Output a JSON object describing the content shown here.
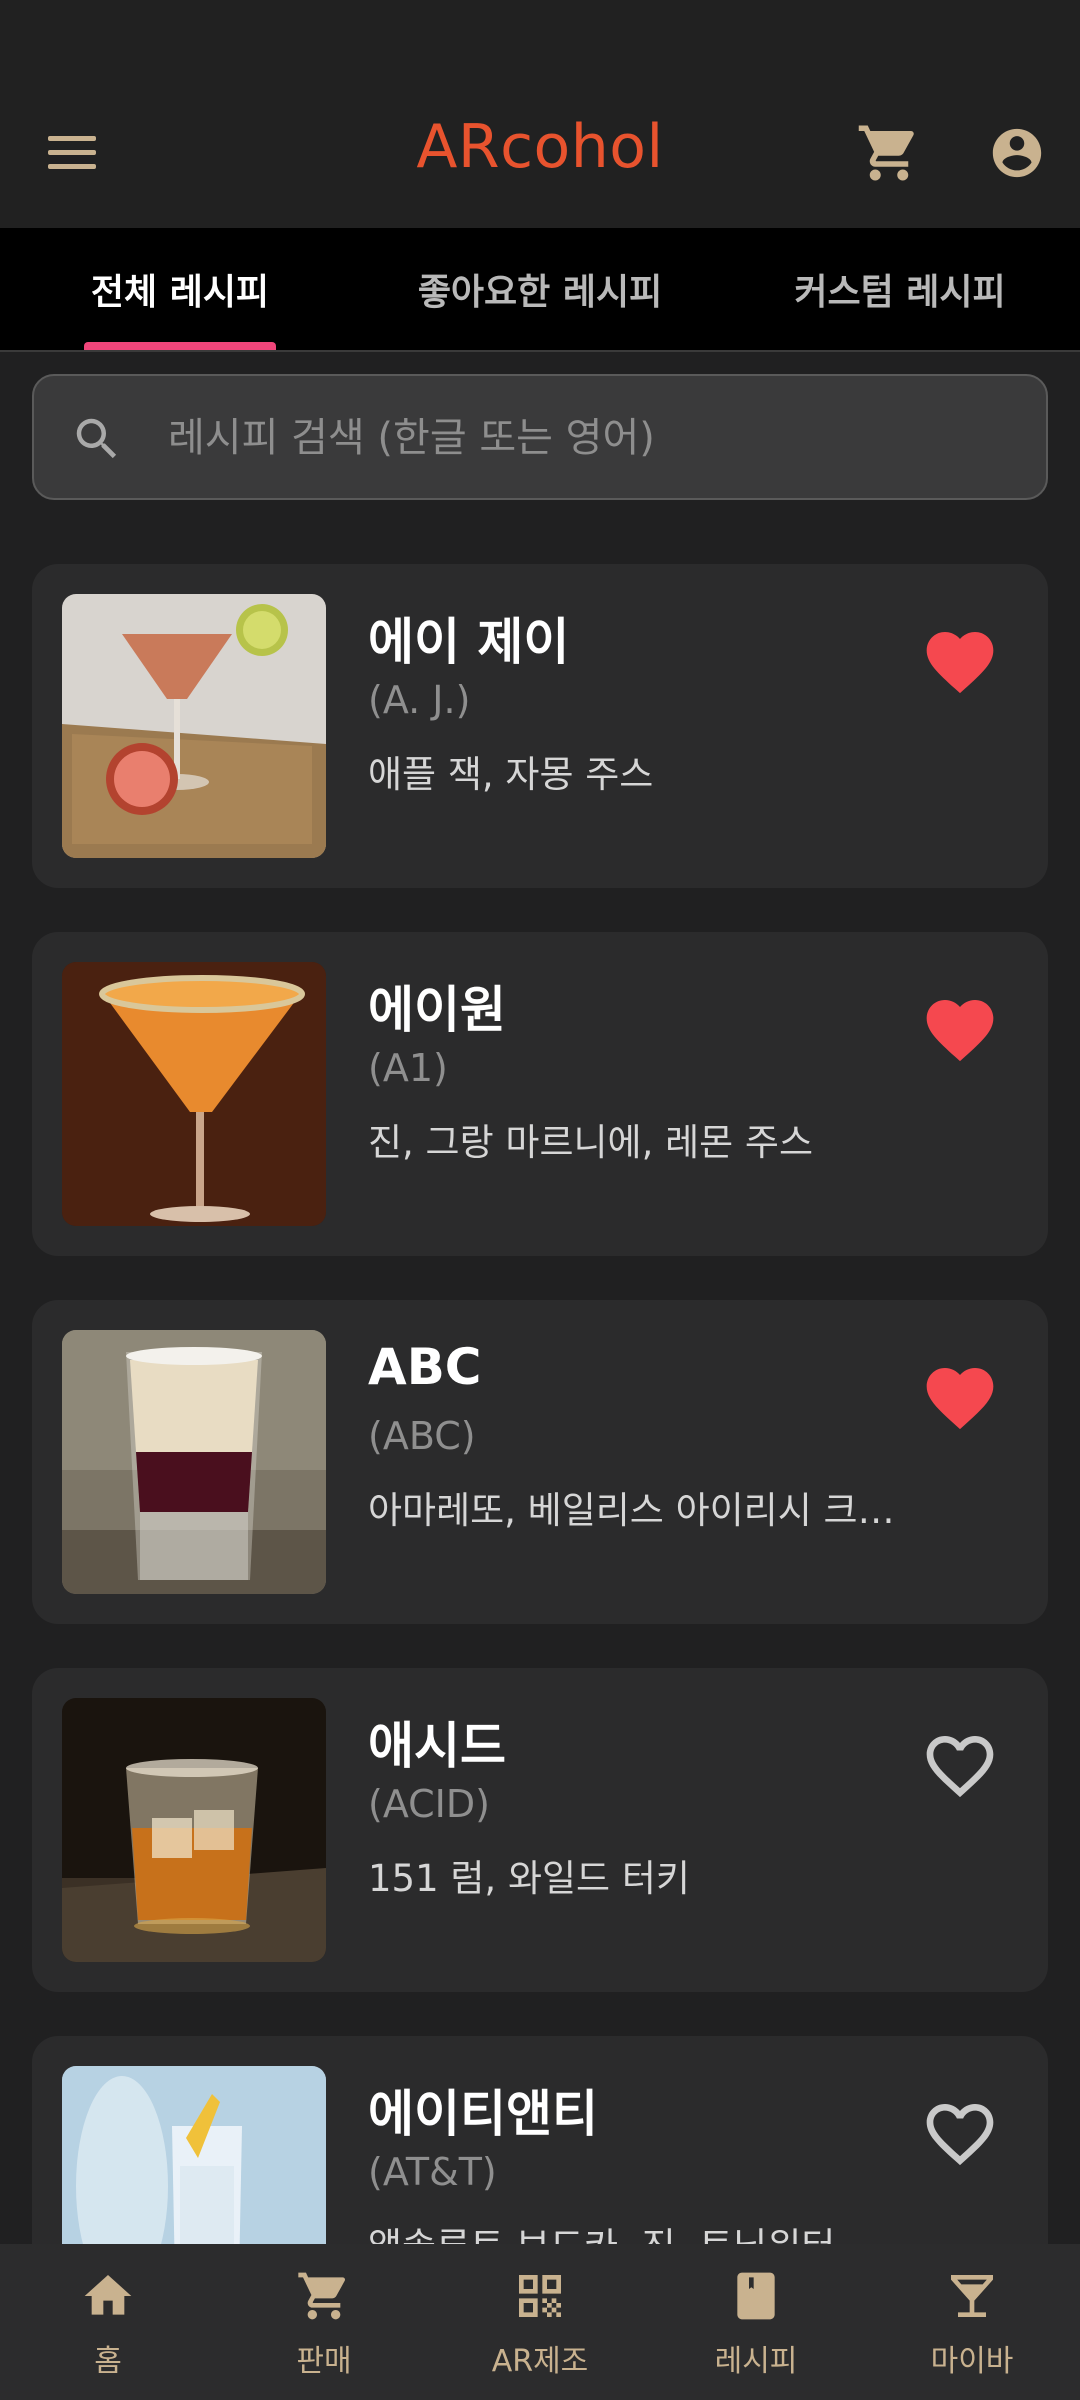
{
  "app": {
    "title": "ARcohol",
    "accent_color": "#e8532e",
    "icon_color": "#c9b28f",
    "tab_indicator_color": "#f0457a"
  },
  "header": {
    "menu_icon": "menu-icon",
    "cart_icon": "cart-icon",
    "account_icon": "account-circle-icon"
  },
  "tabs": [
    {
      "label": "전체 레시피",
      "active": true
    },
    {
      "label": "좋아요한 레시피",
      "active": false
    },
    {
      "label": "커스텀 레시피",
      "active": false
    }
  ],
  "search": {
    "placeholder": "레시피 검색 (한글 또는 영어)",
    "value": ""
  },
  "recipes": [
    {
      "name": "에이 제이",
      "english": "(A. J.)",
      "ingredients": "애플 잭, 자몽 주스",
      "liked": true
    },
    {
      "name": "에이원",
      "english": "(A1)",
      "ingredients": "진, 그랑 마르니에, 레몬 주스",
      "liked": true
    },
    {
      "name": "ABC",
      "english": "(ABC)",
      "ingredients": "아마레또, 베일리스 아이리시 크림, 코냑",
      "liked": true
    },
    {
      "name": "애시드",
      "english": "(ACID)",
      "ingredients": "151 럼, 와일드 터키",
      "liked": false
    },
    {
      "name": "에이티앤티",
      "english": "(AT&T)",
      "ingredients": "앱솔루트 보드카, 진, 토닉워터",
      "liked": false
    }
  ],
  "bottom_nav": [
    {
      "label": "홈",
      "icon": "home-icon"
    },
    {
      "label": "판매",
      "icon": "cart-icon"
    },
    {
      "label": "AR제조",
      "icon": "qr-code-icon"
    },
    {
      "label": "레시피",
      "icon": "book-icon"
    },
    {
      "label": "마이바",
      "icon": "cocktail-glass-icon"
    }
  ]
}
